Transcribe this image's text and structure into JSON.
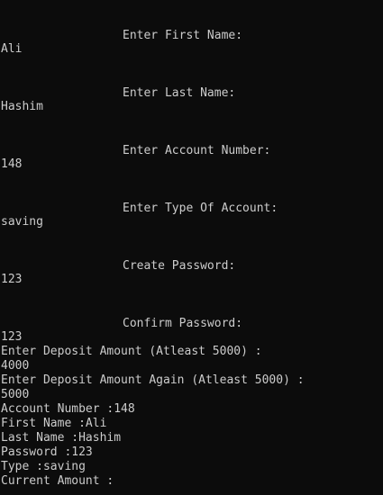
{
  "console": {
    "lines": [
      "Enter First Name:",
      "Ali",
      "Enter Last Name:",
      "Hashim",
      "Enter Account Number:",
      "148",
      "Enter Type Of Account:",
      "saving",
      "Create Password:",
      "123",
      "Confirm Password:",
      "123",
      "Enter Deposit Amount (Atleast 5000) :",
      "4000",
      "Enter Deposit Amount Again (Atleast 5000) :",
      "5000",
      "Account Number :148",
      "First Name :Ali",
      "Last Name :Hashim",
      "Password :123",
      "Type :saving",
      "Current Amount :"
    ]
  },
  "colors": {
    "background": "#0c0c0c",
    "text": "#cccccc"
  }
}
